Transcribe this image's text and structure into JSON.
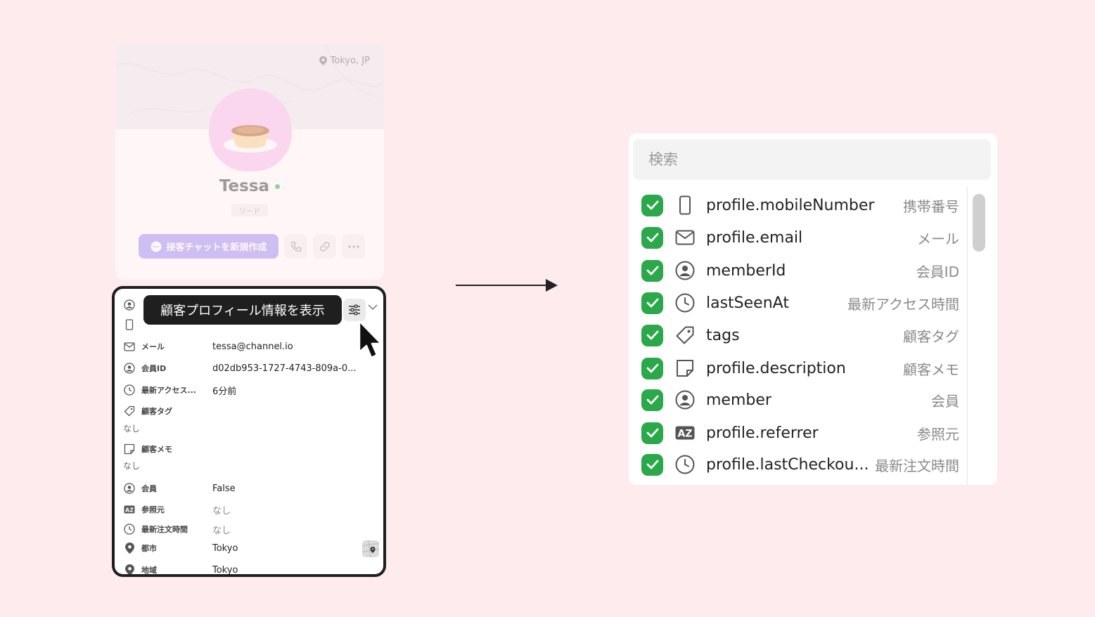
{
  "profile": {
    "location": "Tokyo, JP",
    "name": "Tessa",
    "role": "リード",
    "new_chat_label": "接客チャットを新規作成"
  },
  "detail": {
    "tooltip": "顧客プロフィール情報を表示",
    "rows": [
      {
        "label": "メール",
        "value": "tessa@channel.io"
      },
      {
        "label": "会員ID",
        "value": "d02db953-1727-4743-809a-0..."
      },
      {
        "label": "最新アクセス...",
        "value": "6分前"
      },
      {
        "label": "顧客タグ",
        "value": "なし"
      },
      {
        "label": "顧客メモ",
        "value": "なし"
      },
      {
        "label": "会員",
        "value": "False"
      },
      {
        "label": "参照元",
        "value": "なし"
      },
      {
        "label": "最新注文時間",
        "value": "なし"
      },
      {
        "label": "都市",
        "value": "Tokyo"
      },
      {
        "label": "地域",
        "value": "Tokyo"
      }
    ]
  },
  "dropdown": {
    "search_placeholder": "検索",
    "options": [
      {
        "key": "profile.mobileNumber",
        "name": "携帯番号",
        "icon": "mobile-icon",
        "checked": true
      },
      {
        "key": "profile.email",
        "name": "メール",
        "icon": "mail-icon",
        "checked": true
      },
      {
        "key": "memberId",
        "name": "会員ID",
        "icon": "user-circle-icon",
        "checked": true
      },
      {
        "key": "lastSeenAt",
        "name": "最新アクセス時間",
        "icon": "clock-icon",
        "checked": true
      },
      {
        "key": "tags",
        "name": "顧客タグ",
        "icon": "tag-icon",
        "checked": true
      },
      {
        "key": "profile.description",
        "name": "顧客メモ",
        "icon": "note-icon",
        "checked": true
      },
      {
        "key": "member",
        "name": "会員",
        "icon": "user-circle-icon",
        "checked": true
      },
      {
        "key": "profile.referrer",
        "name": "参照元",
        "icon": "az-text-icon",
        "checked": true
      },
      {
        "key": "profile.lastCheckou...",
        "name": "最新注文時間",
        "icon": "clock-icon",
        "checked": true
      }
    ]
  },
  "colors": {
    "background": "#fdebee",
    "check_green": "#2aa84a",
    "chat_button": "#a99cf6",
    "tooltip_bg": "#1f1f1f"
  }
}
